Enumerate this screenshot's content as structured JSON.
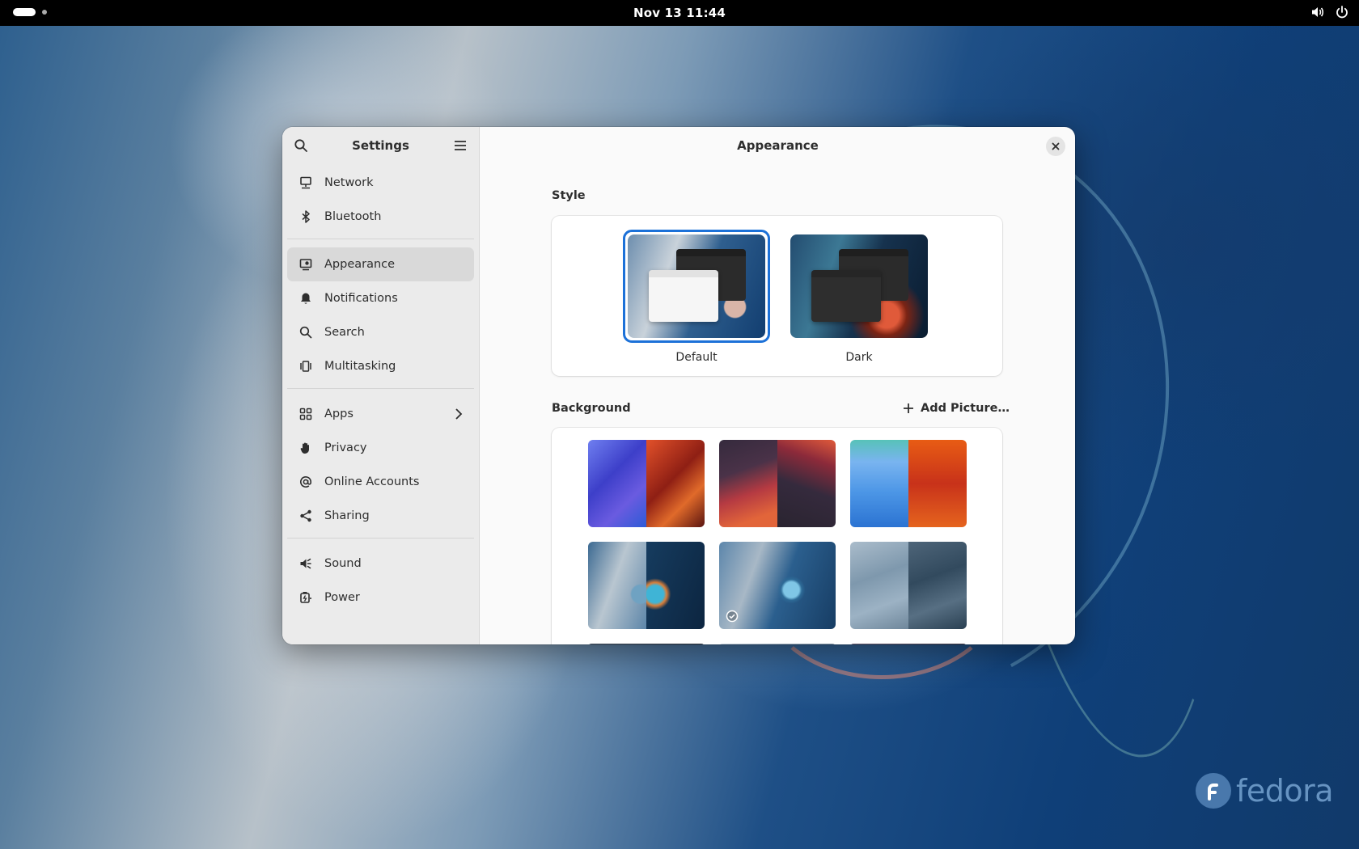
{
  "topbar": {
    "clock": "Nov 13  11:44",
    "icons": [
      "volume-icon",
      "power-icon"
    ]
  },
  "desktop": {
    "logo_text": "fedora"
  },
  "sidebar": {
    "title": "Settings",
    "groups": [
      [
        {
          "label": "Network",
          "icon": "network-icon"
        },
        {
          "label": "Bluetooth",
          "icon": "bluetooth-icon"
        }
      ],
      [
        {
          "label": "Appearance",
          "icon": "appearance-icon",
          "active": true
        },
        {
          "label": "Notifications",
          "icon": "bell-icon"
        },
        {
          "label": "Search",
          "icon": "search-icon"
        },
        {
          "label": "Multitasking",
          "icon": "multitasking-icon"
        }
      ],
      [
        {
          "label": "Apps",
          "icon": "apps-icon",
          "has_submenu": true
        },
        {
          "label": "Privacy",
          "icon": "hand-icon"
        },
        {
          "label": "Online Accounts",
          "icon": "at-icon"
        },
        {
          "label": "Sharing",
          "icon": "share-icon"
        }
      ],
      [
        {
          "label": "Sound",
          "icon": "speaker-icon"
        },
        {
          "label": "Power",
          "icon": "battery-icon"
        }
      ]
    ]
  },
  "content": {
    "title": "Appearance",
    "style": {
      "heading": "Style",
      "options": [
        {
          "label": "Default",
          "selected": true
        },
        {
          "label": "Dark",
          "selected": false
        }
      ]
    },
    "background": {
      "heading": "Background",
      "add_label": "Add Picture…",
      "thumbnails": [
        {
          "name": "blue-red-triangles",
          "left": "#4d5fd6",
          "right": "#c0331c"
        },
        {
          "name": "dark-red-waves",
          "left": "#3d2a3a",
          "right": "#2c2330"
        },
        {
          "name": "blue-orange-drips",
          "left": "#5aa0e8",
          "right": "#e0501a"
        },
        {
          "name": "bubble-split",
          "left": "#9fb6c7",
          "right": "#0f3558"
        },
        {
          "name": "bubble-fedora",
          "left": "#5c86ab",
          "right": "#173d64",
          "selected": true
        },
        {
          "name": "glass-waves",
          "left": "#8aa0b4",
          "right": "#3c5468"
        }
      ]
    }
  }
}
